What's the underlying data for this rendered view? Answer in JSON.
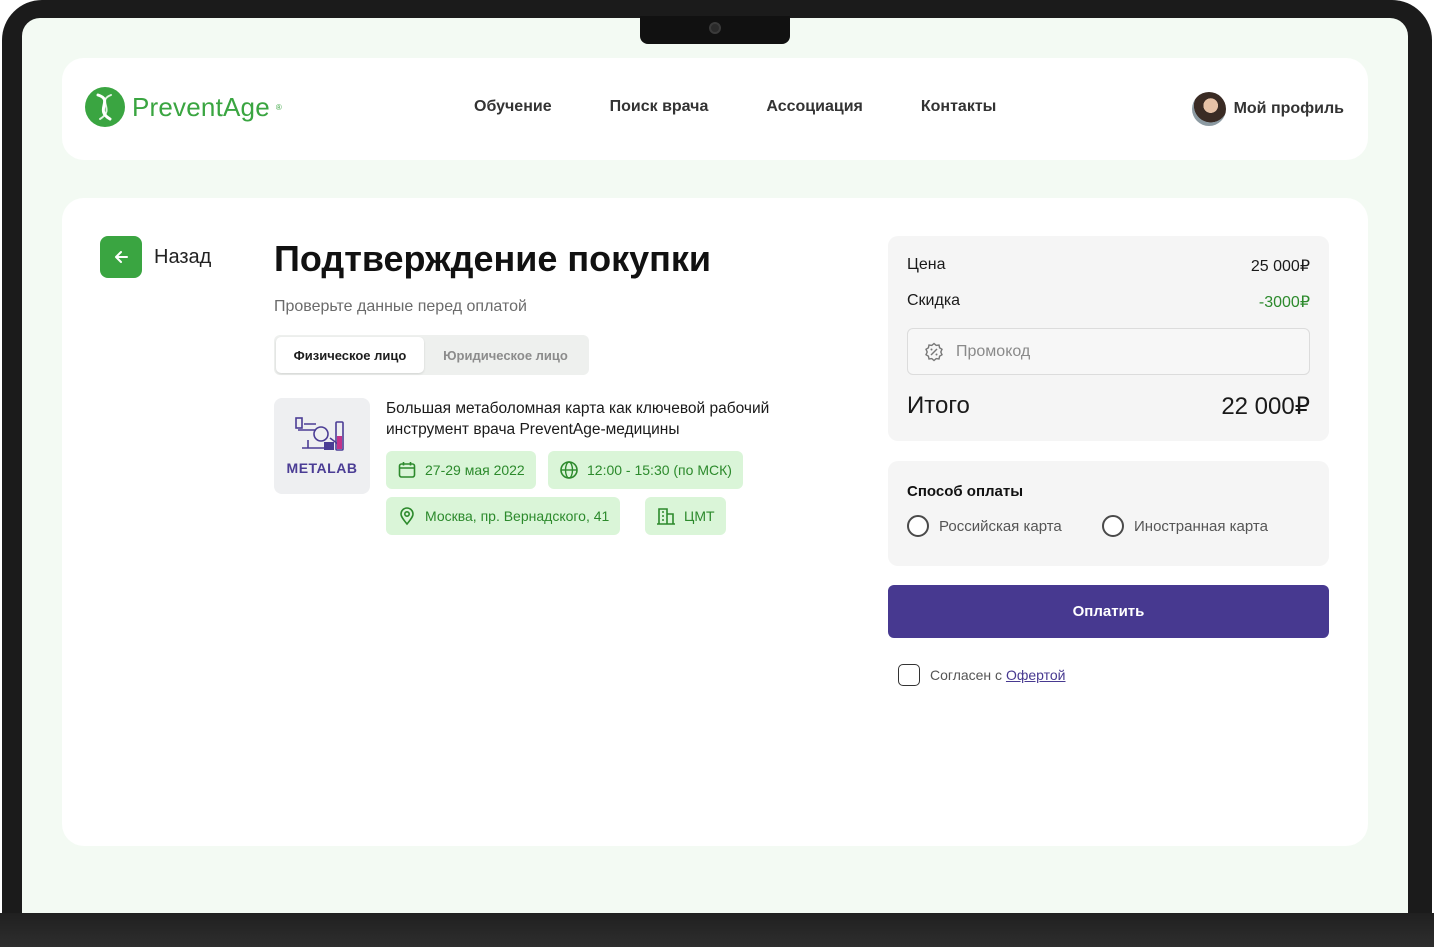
{
  "header": {
    "logo_text": "PreventAge",
    "logo_reg": "®",
    "nav": [
      "Обучение",
      "Поиск врача",
      "Ассоциация",
      "Контакты"
    ],
    "profile_label": "Мой профиль"
  },
  "page": {
    "back_label": "Назад",
    "title": "Подтверждение покупки",
    "subtitle": "Проверьте данные перед оплатой",
    "segment": {
      "active": "Физическое лицо",
      "inactive": "Юридическое лицо"
    }
  },
  "course": {
    "thumb_label": "METALAB",
    "title": "Большая метаболомная карта как ключевой рабочий инструмент врача PreventAge-медицины",
    "date": "27-29 мая 2022",
    "time": "12:00 - 15:30 (по МСК)",
    "address": "Москва, пр. Вернадского, 41",
    "venue": "ЦМТ"
  },
  "summary": {
    "price_label": "Цена",
    "price_value": "25 000₽",
    "discount_label": "Скидка",
    "discount_value": "-3000₽",
    "promo_placeholder": "Промокод",
    "total_label": "Итого",
    "total_value": "22 000₽"
  },
  "payment": {
    "title": "Способ оплаты",
    "options": [
      "Российская карта",
      "Иностранная карта"
    ],
    "pay_button": "Оплатить"
  },
  "agreement": {
    "prefix": "Согласен с",
    "link": "Офертой"
  },
  "colors": {
    "brand_green": "#3aa541",
    "chip_bg": "#daf5d8",
    "accent_purple": "#473990",
    "page_bg": "#f3faf3"
  }
}
